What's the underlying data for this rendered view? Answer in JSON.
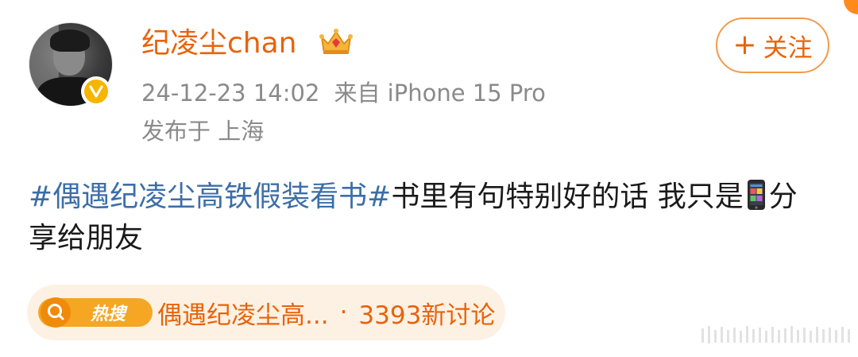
{
  "post": {
    "author": {
      "name": "纪凌尘chan",
      "avatar_icon": "avatar-photo",
      "verified_icon": "v-badge-icon",
      "member_icon": "crown-icon"
    },
    "follow_button": {
      "plus": "+",
      "label": "关注"
    },
    "timestamp": "24-12-23 14:02",
    "source": "来自 iPhone 15 Pro",
    "location": "发布于 上海",
    "content": {
      "hashtag": "#偶遇纪凌尘高铁假装看书#",
      "text_1": "书里有句特别好的话  我只是",
      "emoji_icon": "mobile-phone-icon",
      "text_2": "分享给朋友"
    },
    "hot_search": {
      "badge_label": "热搜",
      "topic": "偶遇纪凌尘高...",
      "separator": "·",
      "count": "3393新讨论"
    }
  },
  "colors": {
    "accent": "#e8630a",
    "hashtag": "#3c6ea8",
    "meta_text": "#8a8a8a",
    "hot_bg": "#fdf1e4",
    "verified": "#f7b500"
  }
}
